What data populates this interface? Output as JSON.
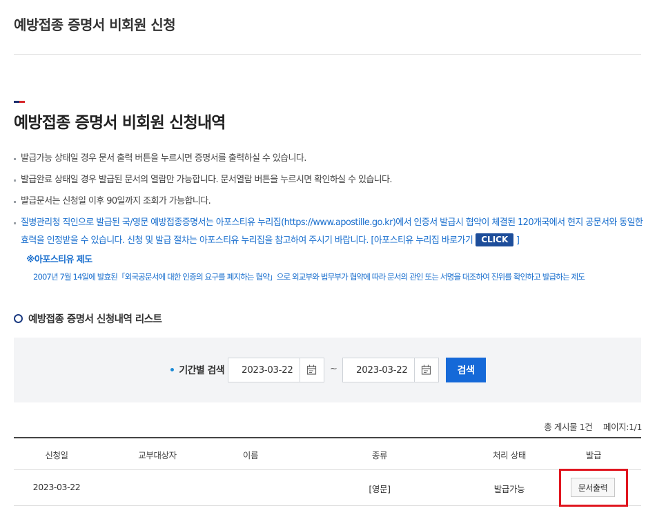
{
  "page": {
    "title": "예방접종 증명서 비회원 신청"
  },
  "section": {
    "title": "예방접종 증명서 비회원 신청내역"
  },
  "notices": [
    "발급가능 상태일 경우 문서 출력 버튼을 누르시면 증명서를 출력하실 수 있습니다.",
    "발급완료 상태일 경우 발급된 문서의 열람만 가능합니다. 문서열람 버튼을 누르시면 확인하실 수 있습니다.",
    "발급문서는 신청일 이후 90일까지 조회가 가능합니다.",
    "질병관리청 직인으로 발급된 국/영문 예방접종증명서는 아포스티유 누리집(https://www.apostille.go.kr)에서 인증서 발급시 협약이 체결된 120개국에서 현지 공문서와 동일한 효력을 인정받을 수 있습니다. 신청 및 발급 절차는 아포스티유 누리집을 참고하여 주시기 바랍니다. [아포스티유 누리집 바로가기"
  ],
  "apostille": {
    "click_label": "CLICK",
    "close_bracket": " ]",
    "system_title": "※아포스티유 제도",
    "system_desc": "2007년 7월 14일에 발효된「외국공문서에 대한 인증의 요구를 폐지하는 협약」으로 외교부와 법무부가 협약에 따라 문서의 관인 또는 서명을 대조하여 진위를 확인하고 발급하는 제도"
  },
  "list": {
    "title": "예방접종 증명서 신청내역 리스트"
  },
  "search": {
    "label": "기간별 검색",
    "start_date": "2023-03-22",
    "separator": "~",
    "end_date": "2023-03-22",
    "button_label": "검색"
  },
  "summary": {
    "total": "총 게시물 1건",
    "page": "페이지:1/1"
  },
  "table": {
    "headers": [
      "신청일",
      "교부대상자",
      "이름",
      "종류",
      "처리 상태",
      "발급"
    ],
    "rows": [
      {
        "date": "2023-03-22",
        "recipient": "",
        "name": "",
        "type": "[영문]",
        "status": "발급가능",
        "action": "문서출력"
      }
    ]
  },
  "colors": {
    "accent_blue": "#1569d8",
    "link_blue": "#1a6fce",
    "highlight_red": "#e0161f"
  }
}
